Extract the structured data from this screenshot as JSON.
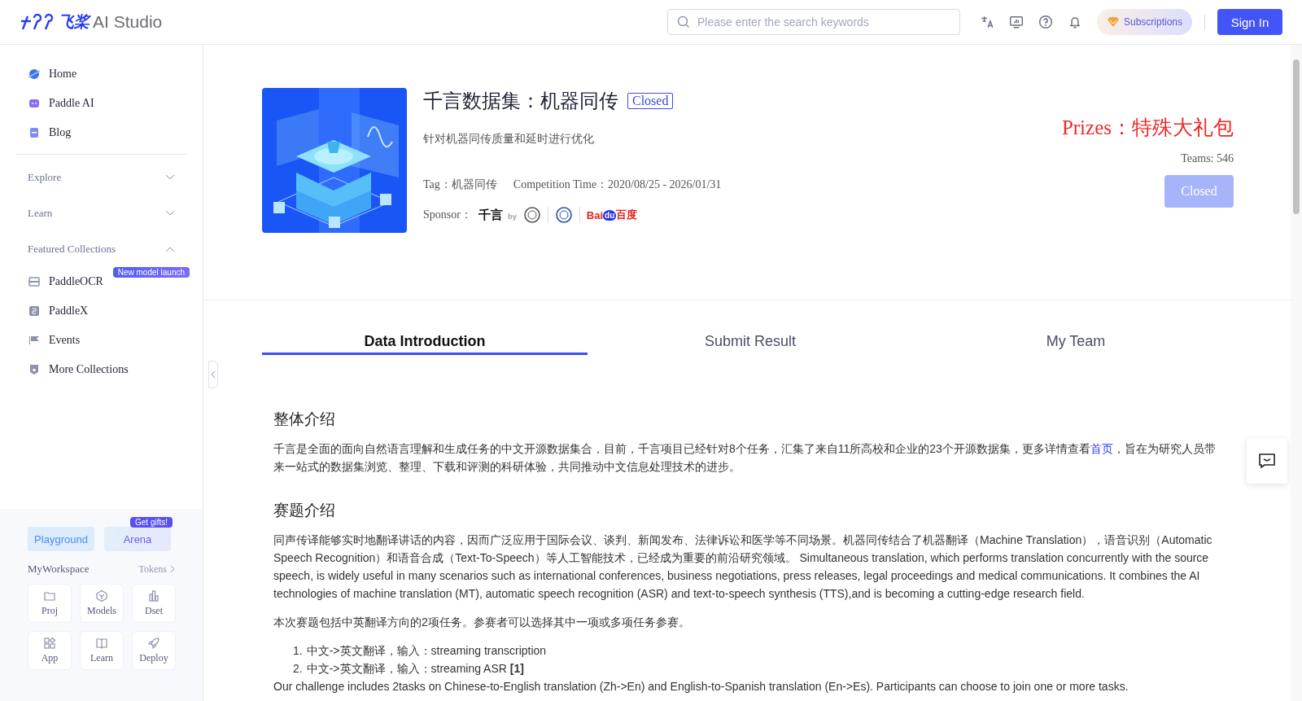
{
  "header": {
    "logo_mark": "飞桨",
    "logo_text": "AI Studio",
    "search": {
      "placeholder": "Please enter the search keywords"
    },
    "subscriptions": "Subscriptions",
    "sign_in": "Sign In"
  },
  "sidebar": {
    "nav": [
      {
        "label": "Home"
      },
      {
        "label": "Paddle AI"
      },
      {
        "label": "Blog"
      }
    ],
    "sections": [
      {
        "label": "Explore",
        "expanded": false
      },
      {
        "label": "Learn",
        "expanded": false
      },
      {
        "label": "Featured Collections",
        "expanded": true
      }
    ],
    "collections": [
      {
        "label": "PaddleOCR",
        "badge": "New model launch"
      },
      {
        "label": "PaddleX"
      },
      {
        "label": "Events"
      },
      {
        "label": "More Collections"
      }
    ],
    "workspace": {
      "modes": [
        {
          "label": "Playground"
        },
        {
          "label": "Arena",
          "badge": "Get gifts!"
        }
      ],
      "title": "MyWorkspace",
      "link": "Tokens",
      "tiles": [
        {
          "label": "Proj"
        },
        {
          "label": "Models"
        },
        {
          "label": "Dset"
        },
        {
          "label": "App"
        },
        {
          "label": "Learn"
        },
        {
          "label": "Deploy"
        }
      ]
    }
  },
  "competition": {
    "title": "千言数据集：机器同传",
    "status": "Closed",
    "subtitle": "针对机器同传质量和延时进行优化",
    "tag_label": "Tag：",
    "tag": "机器同传",
    "time_label": "Competition Time：",
    "time": "2020/08/25 - 2026/01/31",
    "sponsor_label": "Sponsor：",
    "sponsors": [
      {
        "kind": "wordmark",
        "texts": [
          "千言",
          "by"
        ]
      },
      {
        "kind": "seal"
      },
      {
        "kind": "seal"
      },
      {
        "kind": "baidu",
        "texts": [
          "Bai",
          "du",
          "百度"
        ]
      }
    ],
    "prizes": "Prizes：特殊大礼包",
    "teams": "Teams: 546",
    "action": "Closed"
  },
  "tabs": [
    {
      "label": "Data Introduction",
      "selected": true
    },
    {
      "label": "Submit Result",
      "selected": false
    },
    {
      "label": "My Team",
      "selected": false
    }
  ],
  "content": [
    {
      "kind": "heading",
      "text": "整体介绍"
    },
    {
      "kind": "paragraph",
      "parts": [
        {
          "text": "千言是全面的面向自然语言理解和生成任务的中文开源数据集合，目前，千言项目已经针对8个任务，汇集了来自11所高校和企业的23个开源数据集，更多详情查看"
        },
        {
          "kind": "link",
          "text": "首页"
        },
        {
          "text": "，旨在为研究人员带来一站式的数据集浏览、整理、下载和评测的科研体验，共同推动中文信息处理技术的进步。"
        }
      ]
    },
    {
      "kind": "heading",
      "text": "赛题介绍"
    },
    {
      "kind": "paragraph",
      "parts": [
        {
          "text": "同声传译能够实时地翻译讲话的内容，因而广泛应用于国际会议、谈判、新闻发布、法律诉讼和医学等不同场景。机器同传结合了机器翻译（Machine Translation），语音识别（Automatic Speech Recognition）和语音合成（Text-To-Speech）等人工智能技术，已经成为重要的前沿研究领域。 Simultaneous translation, which performs translation concurrently with the source speech, is widely useful in many scenarios such as international conferences, business negotiations, press releases, legal proceedings and medical communications. It combines the AI technologies of machine translation (MT), automatic speech recognition (ASR) and text-to-speech synthesis (TTS),and is becoming a cutting-edge research field."
        }
      ]
    },
    {
      "kind": "paragraph",
      "parts": [
        {
          "text": "本次赛题包括中英翻译方向的2项任务。参赛者可以选择其中一项或多项任务参赛。"
        }
      ]
    },
    {
      "kind": "list",
      "items": [
        {
          "number": "1.",
          "text": "中文->英文翻译，输入：streaming transcription"
        },
        {
          "number": "2.",
          "text": "中文->英文翻译，输入：streaming ASR **[1]**"
        }
      ]
    },
    {
      "kind": "paragraph",
      "parts": [
        {
          "text": "Our challenge includes 2tasks on Chinese-to-English translation (Zh->En) and English-to-Spanish translation (En->Es). Participants can choose to join one or more tasks."
        }
      ]
    }
  ]
}
